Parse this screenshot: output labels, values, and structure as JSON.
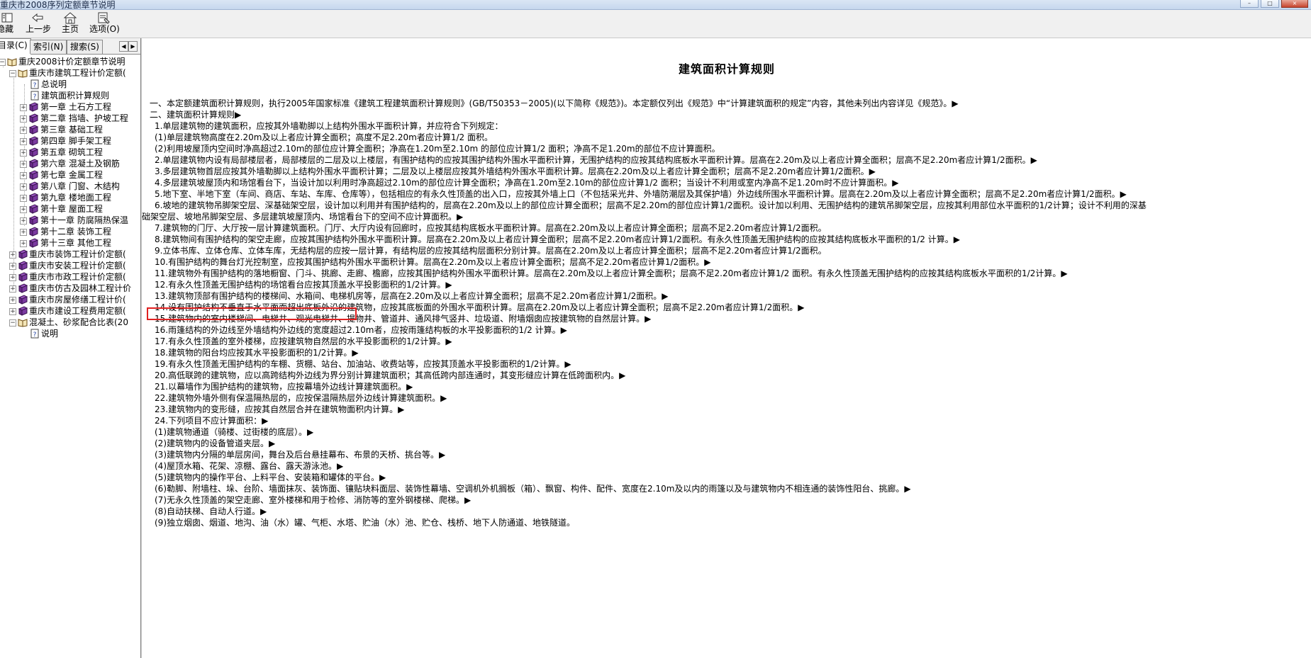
{
  "window": {
    "title": "重庆市2008序列定额章节说明"
  },
  "toolbar": {
    "hide_label": "隐藏",
    "back_label": "上一步",
    "home_label": "主页",
    "options_label": "选项(O)"
  },
  "sidebar": {
    "tabs": [
      {
        "label": "目录(C)"
      },
      {
        "label": "索引(N)"
      },
      {
        "label": "搜索(S)"
      }
    ],
    "tree": [
      {
        "label": "重庆2008计价定额章节说明"
      },
      {
        "label": "重庆市建筑工程计价定额("
      },
      {
        "label": "总说明"
      },
      {
        "label": "建筑面积计算规则"
      },
      {
        "label": "第一章  土石方工程"
      },
      {
        "label": "第二章  挡墙、护坡工程"
      },
      {
        "label": "第三章  基础工程"
      },
      {
        "label": "第四章  脚手架工程"
      },
      {
        "label": "第五章  砌筑工程"
      },
      {
        "label": "第六章  混凝土及钢筋"
      },
      {
        "label": "第七章  金属工程"
      },
      {
        "label": "第八章  门窗、木结构"
      },
      {
        "label": "第九章  楼地面工程"
      },
      {
        "label": "第十章  屋面工程"
      },
      {
        "label": "第十一章 防腐隔热保温"
      },
      {
        "label": "第十二章 装饰工程"
      },
      {
        "label": "第十三章 其他工程"
      },
      {
        "label": "重庆市装饰工程计价定额("
      },
      {
        "label": "重庆市安装工程计价定额("
      },
      {
        "label": "重庆市市政工程计价定额("
      },
      {
        "label": "重庆市仿古及园林工程计价"
      },
      {
        "label": "重庆市房屋修缮工程计价("
      },
      {
        "label": "重庆市建设工程费用定额("
      },
      {
        "label": "混凝土、砂浆配合比表(20"
      },
      {
        "label": "说明"
      }
    ]
  },
  "content": {
    "title": "建筑面积计算规则",
    "lines": [
      "一、本定额建筑面积计算规则，执行2005年国家标准《建筑工程建筑面积计算规则》(GB/T50353－2005)(以下简称《规范》)。本定额仅列出《规范》中“计算建筑面积的规定”内容，其他未列出内容详见《规范》。▶",
      "二、建筑面积计算规则▶",
      "1.单层建筑物的建筑面积，应按其外墙勒脚以上结构外围水平面积计算，并应符合下列规定：",
      "(1)单层建筑物高度在2.20m及以上者应计算全面积；高度不足2.20m者应计算1/2 面积。",
      "(2)利用坡屋顶内空间时净高超过2.10m的部位应计算全面积；净高在1.20m至2.10m 的部位应计算1/2 面积；净高不足1.20m的部位不应计算面积。",
      "2.单层建筑物内设有局部楼层者，局部楼层的二层及以上楼层，有围护结构的应按其围护结构外围水平面积计算，无围护结构的应按其结构底板水平面积计算。层高在2.20m及以上者应计算全面积；层高不足2.20m者应计算1/2面积。▶",
      "3.多层建筑物首层应按其外墙勒脚以上结构外围水平面积计算；二层及以上楼层应按其外墙结构外围水平面积计算。层高在2.20m及以上者应计算全面积；层高不足2.20m者应计算1/2面积。▶",
      "4.多层建筑坡屋顶内和场馆看台下，当设计加以利用时净高超过2.10m的部位应计算全面积；净高在1.20m至2.10m的部位应计算1/2 面积；当设计不利用或室内净高不足1.20m时不应计算面积。▶",
      "5.地下室、半地下室（车间、商店、车站、车库、仓库等），包括相应的有永久性顶盖的出入口，应按其外墙上口（不包括采光井、外墙防潮层及其保护墙）外边线所围水平面积计算。层高在2.20m及以上者应计算全面积；层高不足2.20m者应计算1/2面积。▶",
      "6.坡地的建筑物吊脚架空层、深基础架空层，设计加以利用并有围护结构的，层高在2.20m及以上的部位应计算全面积；层高不足2.20m的部位应计算1/2面积。设计加以利用、无围护结构的建筑吊脚架空层，应按其利用部位水平面积的1/2计算；设计不利用的深基",
      "础架空层、坡地吊脚架空层、多层建筑坡屋顶内、场馆看台下的空间不应计算面积。▶",
      "7.建筑物的门厅、大厅按一层计算建筑面积。门厅、大厅内设有回廊时，应按其结构底板水平面积计算。层高在2.20m及以上者应计算全面积；层高不足2.20m者应计算1/2面积。",
      "8.建筑物间有围护结构的架空走廊，应按其围护结构外围水平面积计算。层高在2.20m及以上者应计算全面积；层高不足2.20m者应计算1/2面积。有永久性顶盖无围护结构的应按其结构底板水平面积的1/2 计算。▶",
      "9.立体书库、立体仓库、立体车库，无结构层的应按一层计算，有结构层的应按其结构层面积分别计算。层高在2.20m及以上者应计算全面积；层高不足2.20m者应计算1/2面积。",
      "10.有围护结构的舞台灯光控制室，应按其围护结构外围水平面积计算。层高在2.20m及以上者应计算全面积；层高不足2.20m者应计算1/2面积。▶",
      "11.建筑物外有围护结构的落地橱窗、门斗、挑廊、走廊、檐廊，应按其围护结构外围水平面积计算。层高在2.20m及以上者应计算全面积；层高不足2.20m者应计算1/2 面积。有永久性顶盖无围护结构的应按其结构底板水平面积的1/2计算。▶",
      "12.有永久性顶盖无围护结构的场馆看台应按其顶盖水平投影面积的1/2计算。▶",
      "13.建筑物顶部有围护结构的楼梯间、水箱间、电梯机房等，层高在2.20m及以上者应计算全面积；层高不足2.20m者应计算1/2面积。▶",
      "14.设有围护结构不垂直于水平面而超出底板外沿的建筑物，应按其底板面的外围水平面积计算。层高在2.20m及以上者应计算全面积；层高不足2.20m者应计算1/2面积。▶",
      "15.建筑物内的室内楼梯间、电梯井、观光电梯井、提物井、管道井、通风排气竖井、垃圾道、附墙烟囱应按建筑物的自然层计算。▶",
      "16.雨篷结构的外边线至外墙结构外边线的宽度超过2.10m者，应按雨篷结构板的水平投影面积的1/2 计算。▶",
      "17.有永久性顶盖的室外楼梯，应按建筑物自然层的水平投影面积的1/2计算。▶",
      "18.建筑物的阳台均应按其水平投影面积的1/2计算。▶",
      "19.有永久性顶盖无围护结构的车棚、货棚、站台、加油站、收费站等，应按其顶盖水平投影面积的1/2计算。▶",
      "20.高低联跨的建筑物，应以高跨结构外边线为界分别计算建筑面积；其高低跨内部连通时，其变形缝应计算在低跨面积内。▶",
      "21.以幕墙作为围护结构的建筑物，应按幕墙外边线计算建筑面积。▶",
      "22.建筑物外墙外侧有保温隔热层的，应按保温隔热层外边线计算建筑面积。▶",
      "23.建筑物内的变形缝，应按其自然层合并在建筑物面积内计算。▶",
      "24.下列项目不应计算面积：▶",
      "(1)建筑物通道（骑楼、过街楼的底层）。▶",
      "(2)建筑物内的设备管道夹层。▶",
      "(3)建筑物内分隔的单层房间，舞台及后台悬挂幕布、布景的天桥、挑台等。▶",
      "(4)屋顶水箱、花架、凉棚、露台、露天游泳池。▶",
      "(5)建筑物内的操作平台、上料平台、安装箱和罐体的平台。▶",
      "(6)勒脚、附墙柱、垛、台阶、墙面抹灰、装饰面、镶贴块料面层、装饰性幕墙、空调机外机搁板（箱）、飘窗、构件、配件、宽度在2.10m及以内的雨篷以及与建筑物内不相连通的装饰性阳台、挑廊。▶",
      "(7)无永久性顶盖的架空走廊、室外楼梯和用于检修、消防等的室外钢楼梯、爬梯。▶",
      "(8)自动扶梯、自动人行道。▶",
      "(9)独立烟囱、烟道、地沟、油（水）罐、气柜、水塔、贮油（水）池、贮仓、栈桥、地下人防通道、地铁隧道。"
    ]
  },
  "colors": {
    "highlight_border": "#e02020",
    "book_icon_purple": "#6a2a8a",
    "titlebar_bg": "#c6d7ee"
  }
}
